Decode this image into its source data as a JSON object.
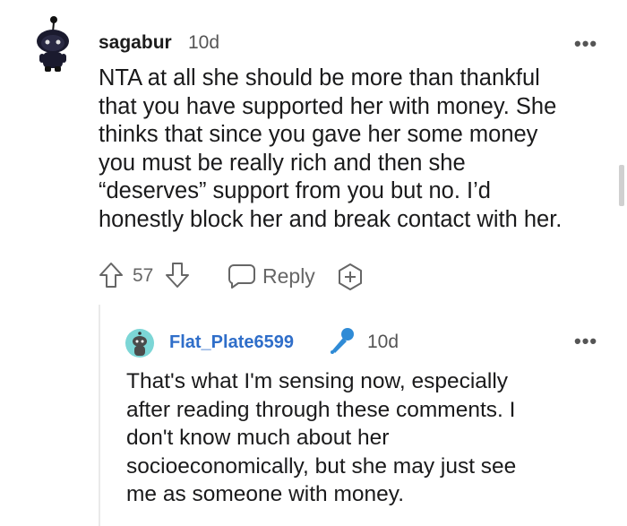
{
  "comment": {
    "username": "sagabur",
    "age": "10d",
    "more": "•••",
    "lines": [
      "NTA at all she should be more than thankful",
      "that you have supported her with money. She",
      "thinks that since you gave her some money",
      "you must be really rich and then she",
      "“deserves” support from you but no. I’d",
      "honestly block her and break contact with her."
    ],
    "actions": {
      "upvote_icon": "arrow-up-icon",
      "score": "57",
      "downvote_icon": "arrow-down-icon",
      "reply_icon": "speech-bubble-icon",
      "reply_label": "Reply",
      "award_icon": "award-plus-icon"
    }
  },
  "reply": {
    "username": "Flat_Plate6599",
    "flair_icon": "microphone-icon",
    "age": "10d",
    "more": "•••",
    "lines": [
      "That's what I'm sensing now, especially",
      "after reading through these comments. I",
      "don't know much about her",
      "socioeconomically, but she may just see",
      "me as someone with money."
    ]
  },
  "colors": {
    "reply_username": "#2f6ec9",
    "flair_icon": "#2f8bd6",
    "reply_avatar_bg": "#7cd6d6"
  }
}
